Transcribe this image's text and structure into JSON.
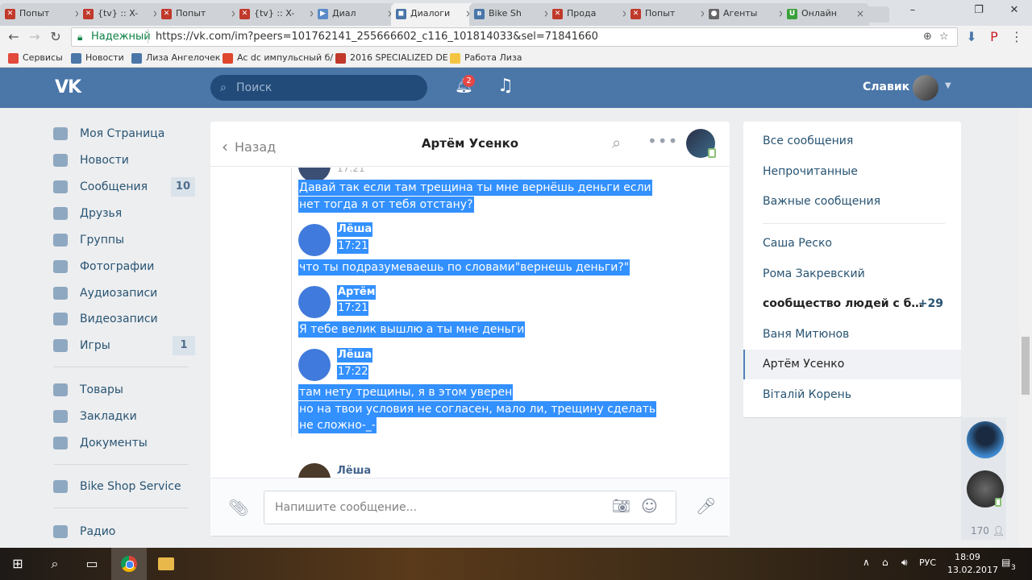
{
  "browser": {
    "tabs": [
      {
        "label": "Попыт",
        "icon": "x-site-icon",
        "color": "#c0392b"
      },
      {
        "label": "{tv} :: X-",
        "icon": "x-site-icon",
        "color": "#c0392b"
      },
      {
        "label": "Попыт",
        "icon": "x-site-icon",
        "color": "#c0392b"
      },
      {
        "label": "{tv} :: X-",
        "icon": "x-site-icon",
        "color": "#c0392b"
      },
      {
        "label": "Диал",
        "icon": "play-icon",
        "color": "#5b8cc9"
      },
      {
        "label": "Диалоги",
        "icon": "vk-dialog-icon",
        "color": "#4a76a8",
        "active": true
      },
      {
        "label": "Bike Sh",
        "icon": "vk-icon",
        "color": "#4a76a8"
      },
      {
        "label": "Прода",
        "icon": "x-site-icon",
        "color": "#c0392b"
      },
      {
        "label": "Попыт",
        "icon": "x-site-icon",
        "color": "#c0392b"
      },
      {
        "label": "Агенты",
        "icon": "agent-icon",
        "color": "#666666"
      },
      {
        "label": "Онлайн",
        "icon": "up-icon",
        "color": "#3aa13a"
      }
    ],
    "secure_label": "Надежный",
    "url": "https://vk.com/im?peers=101762141_255666602_c116_101814033&sel=71841660",
    "bookmarks": [
      {
        "label": "Сервисы",
        "color": "#e24a3b"
      },
      {
        "label": "Новости",
        "color": "#4a76a8"
      },
      {
        "label": "Лиза Ангелочек",
        "color": "#4a76a8"
      },
      {
        "label": "Ac dc импульсный б/",
        "color": "#e0452e"
      },
      {
        "label": "2016 SPECIALIZED DE",
        "color": "#c0392b"
      },
      {
        "label": "Работа Лиза",
        "color": "#f4c542"
      }
    ]
  },
  "vk": {
    "search_placeholder": "Поиск",
    "notifications_count": "2",
    "user_name": "Славик",
    "left_menu": [
      {
        "label": "Моя Страница",
        "icon": "home-icon"
      },
      {
        "label": "Новости",
        "icon": "news-icon"
      },
      {
        "label": "Сообщения",
        "icon": "messages-icon",
        "count": "10"
      },
      {
        "label": "Друзья",
        "icon": "friend-icon"
      },
      {
        "label": "Группы",
        "icon": "groups-icon"
      },
      {
        "label": "Фотографии",
        "icon": "camera-icon"
      },
      {
        "label": "Аудиозаписи",
        "icon": "music-icon"
      },
      {
        "label": "Видеозаписи",
        "icon": "video-icon"
      },
      {
        "label": "Игры",
        "icon": "gamepad-icon",
        "count": "1"
      },
      {
        "label": "Товары",
        "icon": "bag-icon"
      },
      {
        "label": "Закладки",
        "icon": "star-icon"
      },
      {
        "label": "Документы",
        "icon": "document-icon"
      },
      {
        "label": "Bike Shop Service",
        "icon": "groups-icon"
      },
      {
        "label": "Радио",
        "icon": "grid-icon"
      }
    ],
    "dialog": {
      "back_label": "Назад",
      "title": "Артём Усенко",
      "composer_placeholder": "Напишите сообщение...",
      "partial_time": "17:21",
      "messages": [
        {
          "lines": [
            "Давай так если там трещина ты мне вернёшь деньги если",
            "нет тогда я от тебя отстану?"
          ]
        },
        {
          "author": "Лёша",
          "time": "17:21",
          "lines": [
            "что ты подразумеваешь по словами\"вернешь деньги?\""
          ]
        },
        {
          "author": "Артём",
          "time": "17:21",
          "lines": [
            "Я тебе велик вышлю а ты мне деньги"
          ]
        },
        {
          "author": "Лёша",
          "time": "17:22",
          "lines": [
            "там нету трещины, я в этом уверен",
            "но на твои условия не согласен, мало ли, трещину сделать",
            "не сложно-_-"
          ]
        }
      ],
      "last_author": "Лёша"
    },
    "right_menu": {
      "filters": [
        "Все сообщения",
        "Непрочитанные",
        "Важные сообщения"
      ],
      "chats": [
        {
          "label": "Саша Реско"
        },
        {
          "label": "Рома Закревский"
        },
        {
          "label": "сообщество людей с б…",
          "count": "+29",
          "bold": true
        },
        {
          "label": "Ваня Митюнов"
        },
        {
          "label": "Артём Усенко",
          "active": true
        },
        {
          "label": "Віталій Корень"
        }
      ]
    },
    "side_chat_count": "170"
  },
  "taskbar": {
    "lang": "РУС",
    "time": "18:09",
    "date": "13.02.2017",
    "notifications": "3"
  }
}
